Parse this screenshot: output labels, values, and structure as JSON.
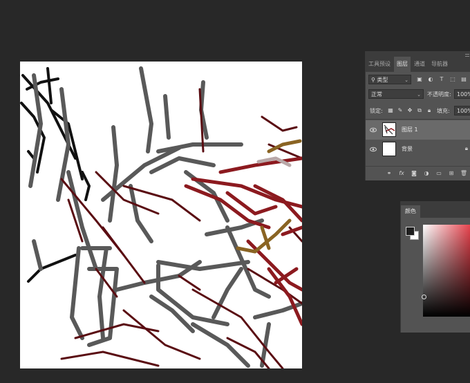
{
  "layers_panel": {
    "tabs": [
      "工具预设",
      "图层",
      "通道",
      "导航器"
    ],
    "active_tab": "图层",
    "filter_kind": "类型",
    "blend_mode": "正常",
    "opacity_label": "不透明度:",
    "opacity_value": "100%",
    "lock_label": "锁定:",
    "fill_label": "填充:",
    "fill_value": "100%",
    "layers": [
      {
        "name": "图层 1",
        "selected": true,
        "locked": false
      },
      {
        "name": "背景",
        "selected": false,
        "locked": true
      }
    ]
  },
  "color_panel": {
    "tab": "颜色",
    "foreground_color": "#1f1f1f",
    "background_color": "#ffffff",
    "hue_color": "#e3232f"
  },
  "colors": {
    "workspace": "#282828",
    "panel": "#535353",
    "panel_tabs": "#3c3c3c",
    "canvas": "#ffffff",
    "stroke_gray": "#555555",
    "stroke_black": "#111111",
    "stroke_dark_red": "#5a0d12",
    "stroke_red": "#8c1a1f",
    "stroke_ochre": "#8a6423"
  }
}
